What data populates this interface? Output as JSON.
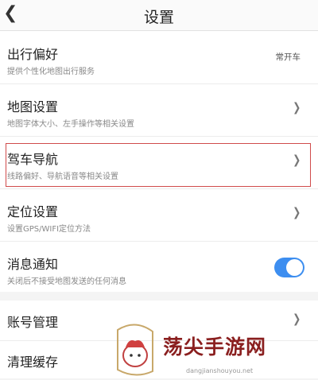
{
  "header": {
    "back_icon": "chevron-left-icon",
    "title": "设置"
  },
  "rows": [
    {
      "label": "出行偏好",
      "sub": "提供个性化地图出行服务",
      "value": "常开车"
    },
    {
      "label": "地图设置",
      "sub": "地图字体大小、左手操作等相关设置"
    },
    {
      "label": "驾车导航",
      "sub": "线路偏好、导航语音等相关设置"
    },
    {
      "label": "定位设置",
      "sub": "设置GPS/WIFI定位方法"
    },
    {
      "label": "消息通知",
      "sub": "关闭后不接受地图发送的任何消息",
      "toggle_on": true
    }
  ],
  "account_rows": [
    {
      "label": "账号管理"
    },
    {
      "label": "清理缓存"
    }
  ],
  "colors": {
    "accent": "#3d8ef0",
    "highlight": "#d04b4b"
  },
  "watermark": {
    "text": "荡尖手游网",
    "url": "dangjianshouyou.net"
  }
}
